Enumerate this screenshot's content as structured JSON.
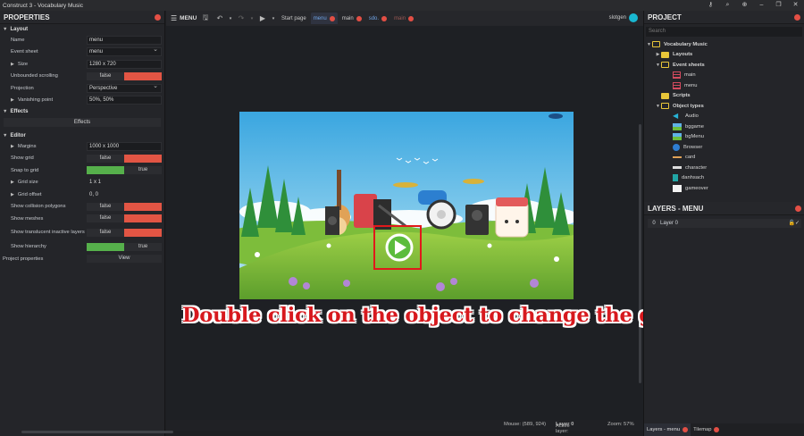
{
  "window": {
    "title": "Construct 3 - Vocabulary Music"
  },
  "properties": {
    "title": "PROPERTIES",
    "sections": {
      "layout": "Layout",
      "effects": "Effects",
      "editor": "Editor"
    },
    "layout_rows": {
      "name_label": "Name",
      "name_value": "menu",
      "eventsheet_label": "Event sheet",
      "eventsheet_value": "menu",
      "size_label": "Size",
      "size_value": "1280 x 720",
      "unbounded_label": "Unbounded scrolling",
      "unbounded_value": "false",
      "projection_label": "Projection",
      "projection_value": "Perspective",
      "vanishing_label": "Vanishing point",
      "vanishing_value": "50%, 50%"
    },
    "effects_button": "Effects",
    "editor_rows": {
      "margins_label": "Margins",
      "margins_value": "1000 x 1000",
      "showgrid_label": "Show grid",
      "showgrid_value": "false",
      "snapgrid_label": "Snap to grid",
      "snapgrid_value": "true",
      "gridsize_label": "Grid size",
      "gridsize_value": "1 x 1",
      "gridoffset_label": "Grid offset",
      "gridoffset_value": "0, 0",
      "collision_label": "Show collision polygons",
      "collision_value": "false",
      "meshes_label": "Show meshes",
      "meshes_value": "false",
      "translucent_label": "Show translucent inactive layers",
      "translucent_value": "false",
      "hierarchy_label": "Show hierarchy",
      "hierarchy_value": "true",
      "projectprops_label": "Project properties",
      "projectprops_button": "View"
    }
  },
  "toolbar": {
    "menu_label": "MENU",
    "tabs": [
      {
        "label": "Start page"
      },
      {
        "label": "menu"
      },
      {
        "label": "main"
      },
      {
        "label": "sdo."
      },
      {
        "label": "main"
      }
    ],
    "user": "slotgen"
  },
  "editor": {
    "instruction": "Double click on the object to change the graphic."
  },
  "status": {
    "mouse": "Mouse: (589, 924)",
    "active_layer": "Active layer: ",
    "active_layer_value": "Layer 0",
    "zoom": "Zoom: 57%"
  },
  "project": {
    "title": "PROJECT",
    "search_placeholder": "Search",
    "tree": [
      {
        "label": "Vocabulary Music",
        "level": 0,
        "kind": "folder-open",
        "bold": true
      },
      {
        "label": "Layouts",
        "level": 1,
        "kind": "folder",
        "bold": true
      },
      {
        "label": "Event sheets",
        "level": 1,
        "kind": "folder-open",
        "bold": true
      },
      {
        "label": "main",
        "level": 2,
        "kind": "eventsheet"
      },
      {
        "label": "menu",
        "level": 2,
        "kind": "eventsheet"
      },
      {
        "label": "Scripts",
        "level": 1,
        "kind": "folder",
        "bold": true
      },
      {
        "label": "Object types",
        "level": 1,
        "kind": "folder-open",
        "bold": true
      },
      {
        "label": "Audio",
        "level": 2,
        "kind": "audio"
      },
      {
        "label": "bggame",
        "level": 2,
        "kind": "sprite-green"
      },
      {
        "label": "bgMenu",
        "level": 2,
        "kind": "sprite-green"
      },
      {
        "label": "Browser",
        "level": 2,
        "kind": "browser"
      },
      {
        "label": "card",
        "level": 2,
        "kind": "sprite-card"
      },
      {
        "label": "character",
        "level": 2,
        "kind": "sprite-char"
      },
      {
        "label": "danhsach",
        "level": 2,
        "kind": "sprite-list"
      },
      {
        "label": "gameover",
        "level": 2,
        "kind": "sprite-white"
      }
    ]
  },
  "layers": {
    "title": "LAYERS - MENU",
    "rows": [
      {
        "index": "0",
        "name": "Layer 0"
      }
    ]
  },
  "bottom_tabs": [
    {
      "label": "Layers - menu"
    },
    {
      "label": "Tilemap"
    }
  ],
  "colors": {
    "accent_red": "#e34f45",
    "true_green": "#56b04b",
    "false_red": "#e25544",
    "instruction_red": "#d7191e",
    "highlight_red": "#e0191b"
  }
}
